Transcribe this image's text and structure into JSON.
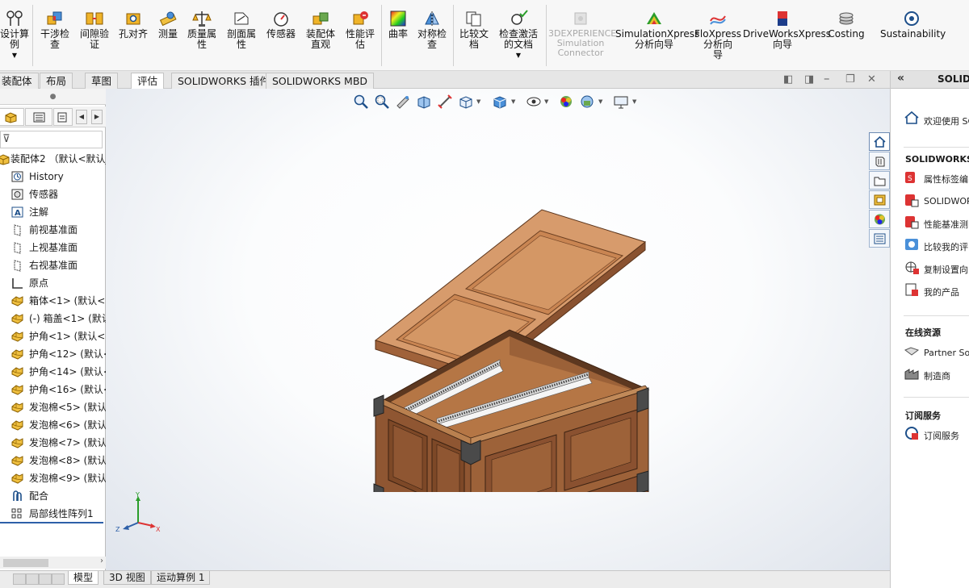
{
  "ribbon": {
    "items": [
      {
        "label": "设计算\n例",
        "icon": "design-study-icon"
      },
      {
        "label": "干涉检\n查",
        "icon": "interference-check-icon"
      },
      {
        "label": "间隙验\n证",
        "icon": "clearance-verification-icon"
      },
      {
        "label": "孔对齐",
        "icon": "hole-alignment-icon"
      },
      {
        "label": "测量",
        "icon": "measure-icon"
      },
      {
        "label": "质量属\n性",
        "icon": "mass-properties-icon"
      },
      {
        "label": "剖面属\n性",
        "icon": "section-properties-icon"
      },
      {
        "label": "传感器",
        "icon": "sensor-icon"
      },
      {
        "label": "装配体\n直观",
        "icon": "assemblyxpert-icon"
      },
      {
        "label": "性能评\n估",
        "icon": "performance-evaluation-icon"
      },
      {
        "label": "曲率",
        "icon": "curvature-icon"
      },
      {
        "label": "对称检\n查",
        "icon": "symmetry-check-icon"
      },
      {
        "label": "比较文\n档",
        "icon": "compare-documents-icon"
      },
      {
        "label": "检查激活\n的文档",
        "icon": "check-active-document-icon"
      },
      {
        "label": "3DEXPERIENCE\nSimulation\nConnector",
        "icon": "3dexperience-icon"
      },
      {
        "label": "SimulationXpress\n分析向导",
        "icon": "simulationxpress-icon"
      },
      {
        "label": "FloXpress\n分析向\n导",
        "icon": "floxpress-icon"
      },
      {
        "label": "DriveWorksXpress\n向导",
        "icon": "driveworksxpress-icon"
      },
      {
        "label": "Costing",
        "icon": "costing-icon"
      },
      {
        "label": "Sustainability",
        "icon": "sustainability-icon"
      }
    ]
  },
  "command_tabs": [
    "装配体",
    "布局",
    "草图",
    "评估",
    "SOLIDWORKS 插件",
    "SOLIDWORKS MBD"
  ],
  "active_command_tab": "评估",
  "feature_tree": {
    "root": "装配体2 （默认<默认_",
    "items": [
      {
        "label": "History",
        "icon": "history-icon"
      },
      {
        "label": "传感器",
        "icon": "sensors-folder-icon"
      },
      {
        "label": "注解",
        "icon": "annotations-icon"
      },
      {
        "label": "前视基准面",
        "icon": "plane-icon"
      },
      {
        "label": "上视基准面",
        "icon": "plane-icon"
      },
      {
        "label": "右视基准面",
        "icon": "plane-icon"
      },
      {
        "label": "原点",
        "icon": "origin-icon"
      },
      {
        "label": "箱体<1> (默认<",
        "icon": "part-icon"
      },
      {
        "label": "(-) 箱盖<1> (默认",
        "icon": "part-icon"
      },
      {
        "label": "护角<1> (默认<",
        "icon": "part-icon"
      },
      {
        "label": "护角<12> (默认<",
        "icon": "part-icon"
      },
      {
        "label": "护角<14> (默认<",
        "icon": "part-icon"
      },
      {
        "label": "护角<16> (默认<",
        "icon": "part-icon"
      },
      {
        "label": "发泡棉<5> (默认",
        "icon": "part-icon"
      },
      {
        "label": "发泡棉<6> (默认",
        "icon": "part-icon"
      },
      {
        "label": "发泡棉<7> (默认",
        "icon": "part-icon"
      },
      {
        "label": "发泡棉<8> (默认",
        "icon": "part-icon"
      },
      {
        "label": "发泡棉<9> (默认",
        "icon": "part-icon"
      },
      {
        "label": "配合",
        "icon": "mates-icon"
      },
      {
        "label": "局部线性阵列1",
        "icon": "linear-pattern-icon"
      }
    ]
  },
  "bottom_tabs": [
    "模型",
    "3D 视图",
    "运动算例 1"
  ],
  "active_bottom_tab": "模型",
  "triad": {
    "x": "X",
    "y": "Y",
    "z": "Z"
  },
  "task_pane": {
    "title": "SOLID",
    "welcome": "欢迎使用  SO",
    "tools_header": "SOLIDWORKS 工",
    "tools": [
      {
        "label": "属性标签编",
        "icon": "property-tab-builder-icon"
      },
      {
        "label": "SOLIDWOR",
        "icon": "solidworks-rx-icon"
      },
      {
        "label": "性能基准测",
        "icon": "benchmark-icon"
      },
      {
        "label": "比较我的评",
        "icon": "compare-score-icon"
      },
      {
        "label": "复制设置向",
        "icon": "copy-settings-icon"
      },
      {
        "label": "我的产品",
        "icon": "my-products-icon"
      }
    ],
    "online_header": "在线资源",
    "online": [
      {
        "label": "Partner Sol",
        "icon": "partner-solutions-icon"
      },
      {
        "label": "制造商",
        "icon": "manufacturer-icon"
      }
    ],
    "subscription_header": "订阅服务",
    "subscription": [
      {
        "label": "订阅服务",
        "icon": "subscription-icon"
      }
    ]
  },
  "colors": {
    "wood_light": "#c98a5a",
    "wood_mid": "#a8693f",
    "wood_dark": "#7a4a2a",
    "corner": "#4a4a4a",
    "accent": "#2d5fa8"
  }
}
